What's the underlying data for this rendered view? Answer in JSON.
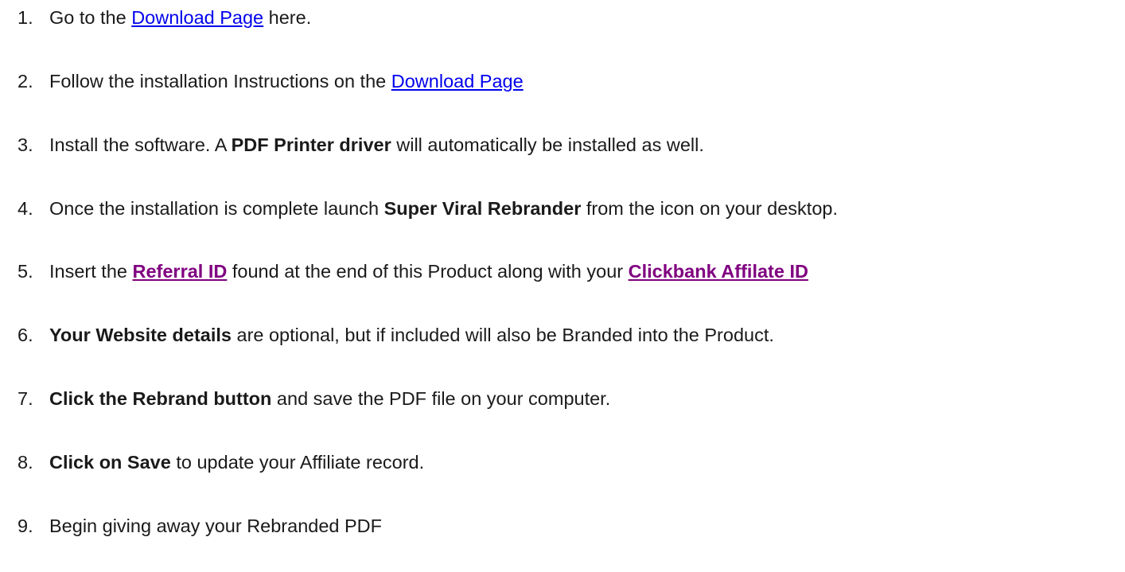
{
  "steps": [
    {
      "number": "1.",
      "before": "Go to the ",
      "link": "Download Page",
      "after": " here."
    },
    {
      "number": "2.",
      "before": "Follow the installation Instructions on the ",
      "link": "Download Page"
    },
    {
      "number": "3.",
      "before": "Install the software. A ",
      "bold": "PDF Printer driver",
      "after": " will automatically be installed as well."
    },
    {
      "number": "4.",
      "before": "Once the installation is complete launch ",
      "bold": "Super Viral Rebrander",
      "after": " from the icon on your desktop."
    },
    {
      "number": "5.",
      "before": "Insert the ",
      "link1": "Referral ID",
      "middle": " found at the end of this Product along with your ",
      "link2": "Clickbank Affilate ID"
    },
    {
      "number": "6.",
      "bold": "Your Website details",
      "after": " are optional, but if included will also be Branded into the Product."
    },
    {
      "number": "7.",
      "bold": "Click the Rebrand button",
      "after": " and save the PDF file on your computer."
    },
    {
      "number": "8.",
      "bold": "Click on Save",
      "after": " to update your Affiliate record."
    },
    {
      "number": "9.",
      "before": "Begin giving away your Rebranded PDF"
    }
  ],
  "colors": {
    "link": "#0000ee",
    "visited_link": "#800080",
    "text": "#1a1a1a",
    "background": "#ffffff"
  }
}
